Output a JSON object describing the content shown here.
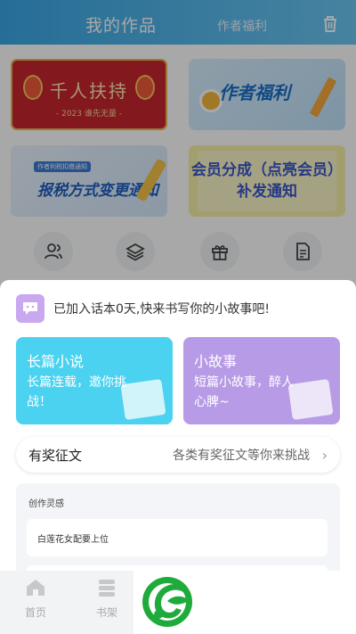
{
  "header": {
    "tab_works": "我的作品",
    "tab_welfare": "作者福利",
    "trash_icon": "trash-icon"
  },
  "banners": [
    {
      "title": "千人扶持",
      "subtitle": "- 2023 谁先无量 -"
    },
    {
      "title": "作者福利"
    },
    {
      "tag": "作者利税扣缴通知",
      "title": "报税方式变更通知"
    },
    {
      "title": "会员分成（点亮会员）补发通知"
    }
  ],
  "quick_icons": [
    "people-icon",
    "layers-icon",
    "gift-icon",
    "document-icon"
  ],
  "sheet": {
    "notice": "已加入话本0天,快来书写你的小故事吧!",
    "cards": [
      {
        "title": "长篇小说",
        "desc": "长篇连载，邀你挑战！",
        "color": "#4ad2f0"
      },
      {
        "title": "小故事",
        "desc": "短篇小故事，醉人心脾~",
        "color": "#b79be6"
      }
    ],
    "contest": {
      "title": "有奖征文",
      "subtitle": "各类有奖征文等你来挑战",
      "arrow": "›"
    },
    "inspiration": {
      "title": "创作灵感",
      "items": [
        "白莲花女配要上位",
        ""
      ]
    }
  },
  "bottom_nav": [
    {
      "label": "首页",
      "icon": "home-icon"
    },
    {
      "label": "书架",
      "icon": "bookshelf-icon"
    }
  ],
  "colors": {
    "header": "#3aa8e6",
    "long_card": "#4ad2f0",
    "short_card": "#b79be6",
    "logo_green": "#1faa3c"
  }
}
